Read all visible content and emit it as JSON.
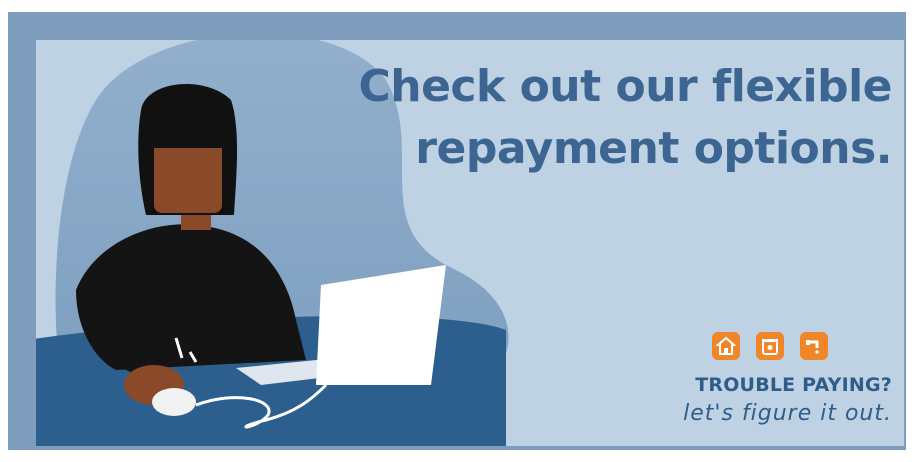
{
  "ad": {
    "headline_line1": "Check out our flexible",
    "headline_line2": "repayment options.",
    "tagline_title": "TROUBLE PAYING?",
    "tagline_sub": "let's figure it out."
  },
  "icons": [
    "house-icon",
    "trash-can-icon",
    "faucet-icon"
  ],
  "colors": {
    "frame": "#7e9dbd",
    "panel": "#bfd2e3",
    "blob": "#8cabcb",
    "desk": "#2c5f8e",
    "headline": "#3c6592",
    "icon_bg": "#f0862a",
    "skin": "#8a4a2a",
    "hair": "#111111"
  }
}
